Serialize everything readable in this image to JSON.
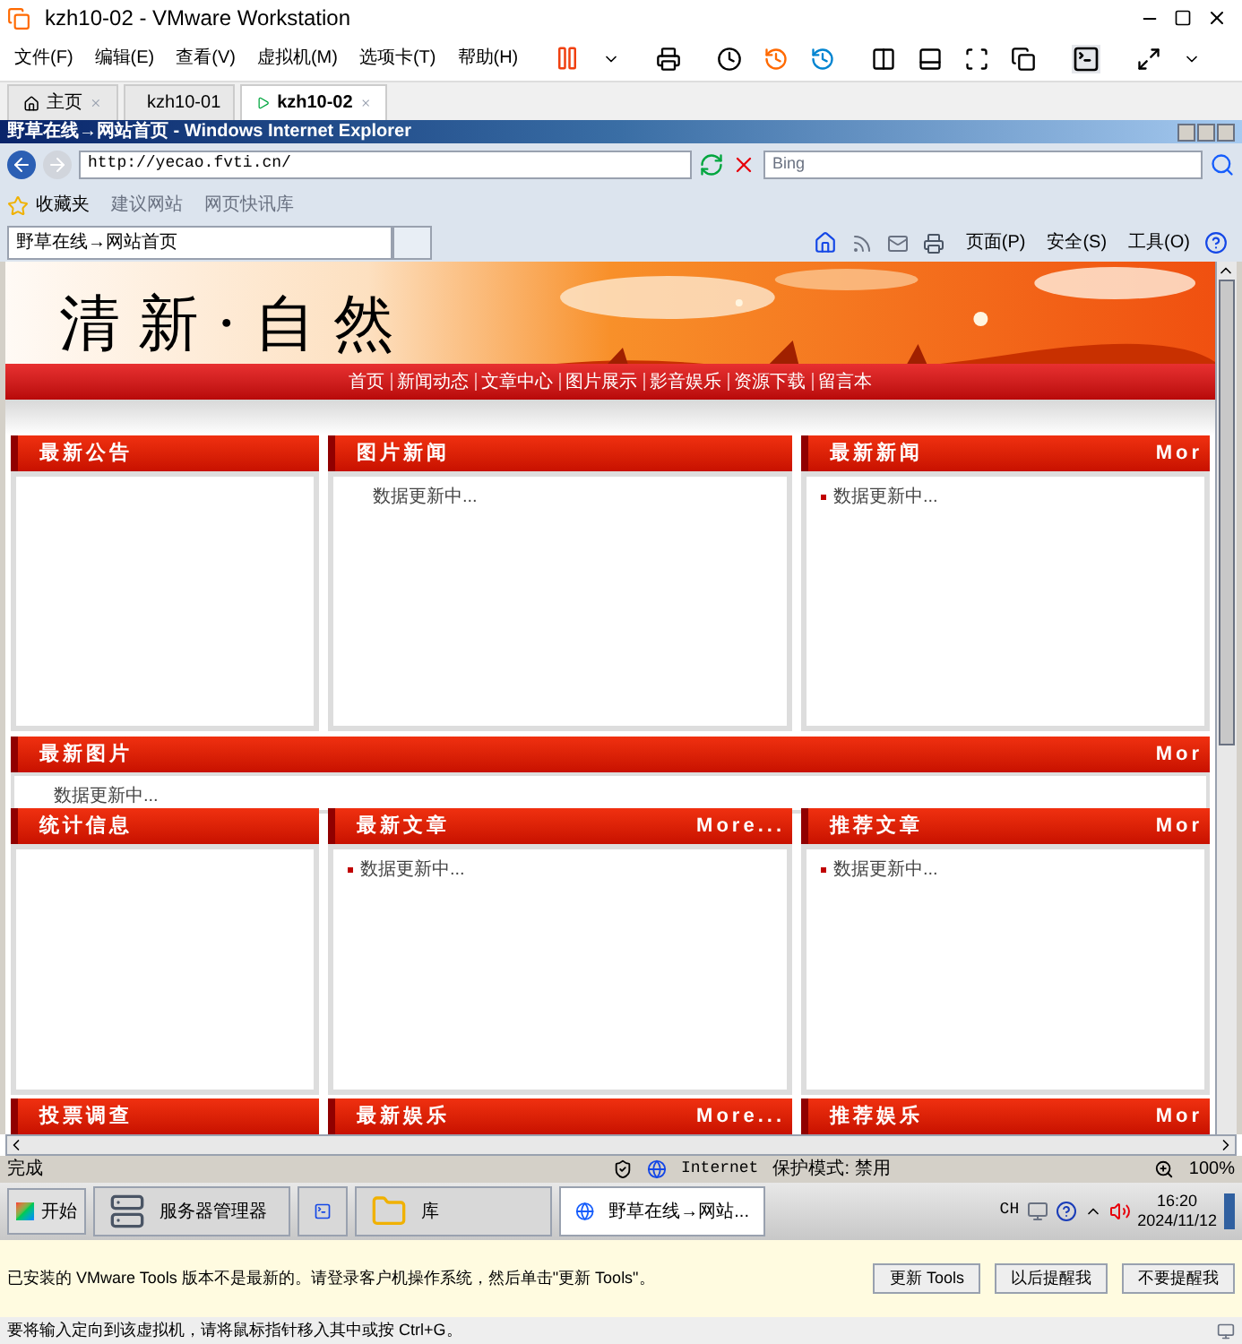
{
  "window": {
    "title": "kzh10-02 - VMware Workstation"
  },
  "menu": [
    "文件(F)",
    "编辑(E)",
    "查看(V)",
    "虚拟机(M)",
    "选项卡(T)",
    "帮助(H)"
  ],
  "tabs": [
    {
      "label": "主页",
      "kind": "home",
      "selected": false
    },
    {
      "label": "kzh10-01",
      "kind": "vm",
      "selected": false
    },
    {
      "label": "kzh10-02",
      "kind": "vm",
      "selected": true
    }
  ],
  "browser": {
    "title": "野草在线→网站首页 - Windows Internet Explorer",
    "address": "http://yecao.fvti.cn/",
    "search_placeholder": "Bing",
    "favorites_label": "收藏夹",
    "favorites": [
      "建议网站",
      "网页快讯库"
    ],
    "tab": "野草在线→网站首页",
    "commands": [
      "页面(P)",
      "安全(S)",
      "工具(O)"
    ]
  },
  "page": {
    "site_title": "清新·自然",
    "nav": [
      "首页",
      "新闻动态",
      "文章中心",
      "图片展示",
      "影音娱乐",
      "资源下载",
      "留言本"
    ],
    "rows": [
      {
        "kind": "columns",
        "panels": [
          {
            "title": "最新公告"
          },
          {
            "title": "图片新闻",
            "items": [
              {
                "text": "数据更新中...",
                "bulleted": false
              }
            ]
          },
          {
            "title": "最新新闻",
            "more": "Mor",
            "items": [
              {
                "text": "数据更新中...",
                "bulleted": true
              }
            ]
          }
        ]
      },
      {
        "kind": "wide",
        "panels": [
          {
            "title": "最新图片",
            "more": "Mor",
            "items": [
              {
                "text": "数据更新中...",
                "bulleted": false
              }
            ]
          }
        ]
      },
      {
        "kind": "columns",
        "panels": [
          {
            "title": "统计信息"
          },
          {
            "title": "最新文章",
            "more": "More...",
            "items": [
              {
                "text": "数据更新中...",
                "bulleted": true
              }
            ]
          },
          {
            "title": "推荐文章",
            "more": "Mor",
            "items": [
              {
                "text": "数据更新中...",
                "bulleted": true
              }
            ]
          }
        ]
      },
      {
        "kind": "cut",
        "panels": [
          {
            "title": "投票调查"
          },
          {
            "title": "最新娱乐",
            "more": "More..."
          },
          {
            "title": "推荐娱乐",
            "more": "Mor"
          }
        ]
      }
    ]
  },
  "status": {
    "text": "完成",
    "zone": "Internet",
    "protected_mode": "保护模式: 禁用",
    "zoom": "100%"
  },
  "taskbar": {
    "start": "开始",
    "items": [
      {
        "label": "服务器管理器",
        "kind": "server",
        "selected": false
      },
      {
        "kind": "shell",
        "selected": false
      },
      {
        "label": "库",
        "kind": "folder",
        "selected": false
      },
      {
        "label": "野草在线→网站...",
        "kind": "ie",
        "selected": true
      }
    ],
    "lang": "CH",
    "time": "16:20",
    "date": "2024/11/12"
  },
  "notice": {
    "text": "已安装的 VMware Tools 版本不是最新的。请登录客户机操作系统，然后单击\"更新 Tools\"。",
    "buttons": [
      "更新 Tools",
      "以后提醒我",
      "不要提醒我"
    ]
  },
  "vm_status": "要将输入定向到该虚拟机，请将鼠标指针移入其中或按 Ctrl+G。"
}
